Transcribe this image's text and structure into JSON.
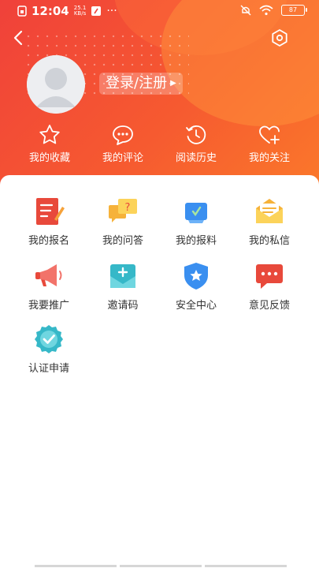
{
  "status_bar": {
    "time": "12:04",
    "speed_value": "25.1",
    "speed_unit": "KB/s",
    "more": "···",
    "battery": "87"
  },
  "profile": {
    "login_label": "登录/注册"
  },
  "quick_actions": [
    {
      "label": "我的收藏",
      "icon": "star-icon"
    },
    {
      "label": "我的评论",
      "icon": "comment-icon"
    },
    {
      "label": "阅读历史",
      "icon": "history-icon"
    },
    {
      "label": "我的关注",
      "icon": "heart-plus-icon"
    }
  ],
  "grid": [
    {
      "label": "我的报名",
      "icon": "signup-icon"
    },
    {
      "label": "我的问答",
      "icon": "qa-icon"
    },
    {
      "label": "我的报料",
      "icon": "report-icon"
    },
    {
      "label": "我的私信",
      "icon": "mail-icon"
    },
    {
      "label": "我要推广",
      "icon": "megaphone-icon"
    },
    {
      "label": "邀请码",
      "icon": "invite-icon"
    },
    {
      "label": "安全中心",
      "icon": "shield-icon"
    },
    {
      "label": "意见反馈",
      "icon": "feedback-icon"
    },
    {
      "label": "认证申请",
      "icon": "verify-badge-icon"
    }
  ],
  "colors": {
    "header_start": "#f0413a",
    "header_end": "#fb7a2a",
    "text": "#333333"
  }
}
